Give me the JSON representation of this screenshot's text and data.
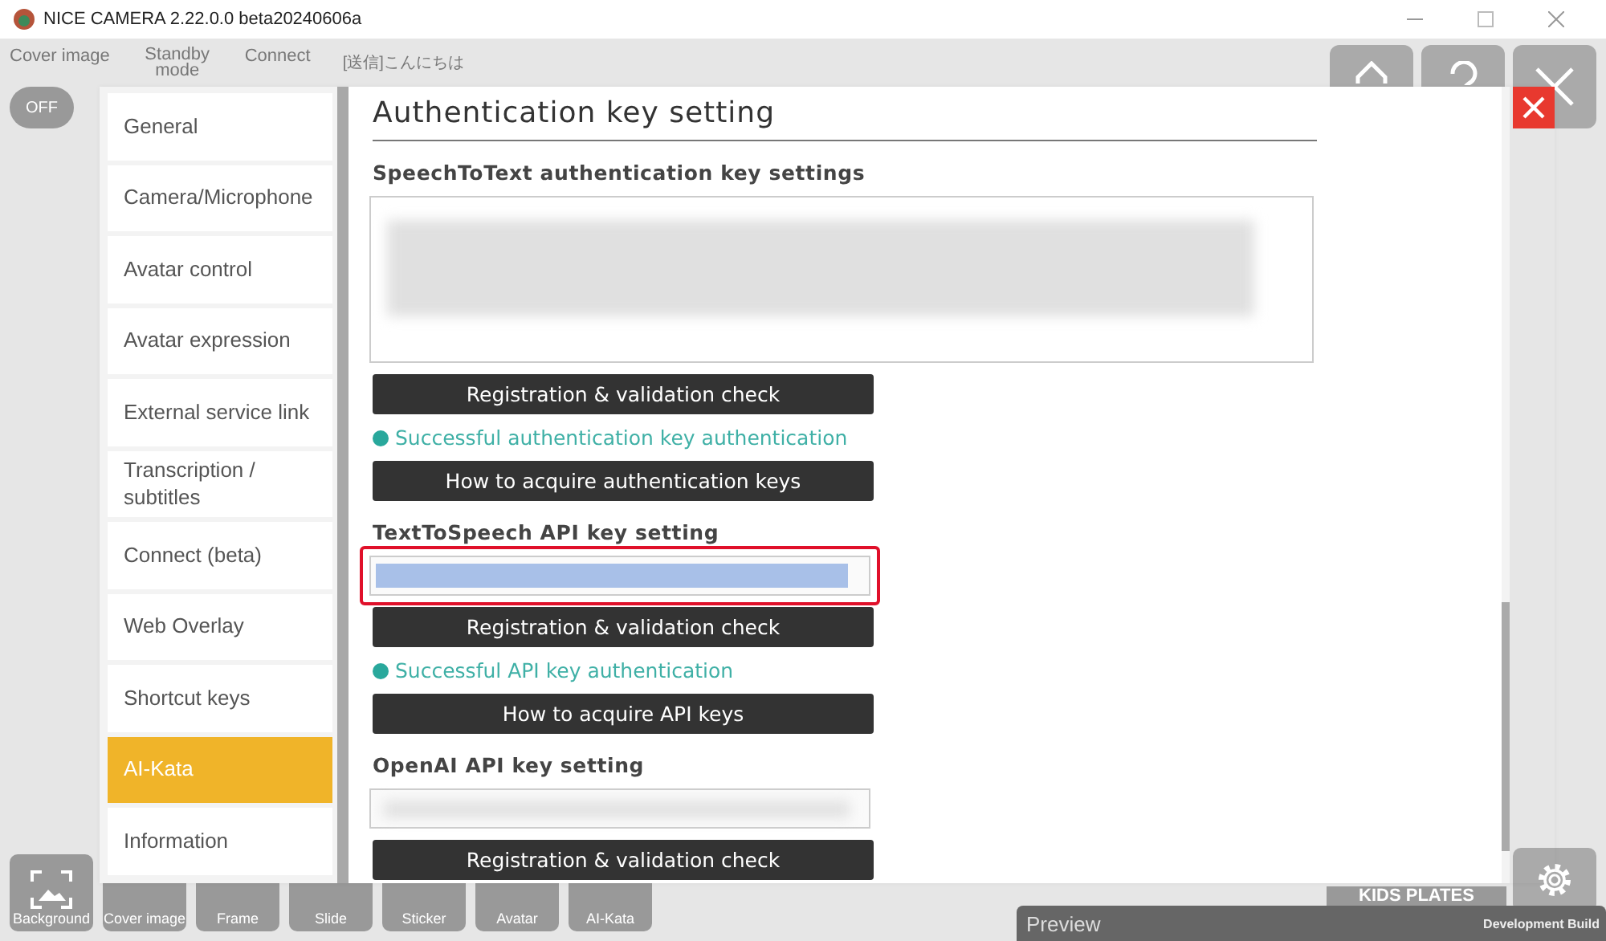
{
  "window": {
    "title": "NICE CAMERA 2.22.0.0 beta20240606a"
  },
  "toolbar": {
    "items": [
      {
        "label": "Cover image"
      },
      {
        "label": "Standby mode"
      },
      {
        "label": "Connect"
      }
    ],
    "message": "[送信]こんにちは",
    "toggle": {
      "label": "OFF",
      "on": false
    }
  },
  "sidebar": {
    "items": [
      {
        "label": "General",
        "selected": false
      },
      {
        "label": "Camera/Microphone",
        "selected": false
      },
      {
        "label": "Avatar control",
        "selected": false
      },
      {
        "label": "Avatar expression",
        "selected": false
      },
      {
        "label": "External service link",
        "selected": false
      },
      {
        "label": "Transcription / subtitles",
        "selected": false
      },
      {
        "label": "Connect (beta)",
        "selected": false
      },
      {
        "label": "Web Overlay",
        "selected": false
      },
      {
        "label": "Shortcut keys",
        "selected": false
      },
      {
        "label": "AI-Kata",
        "selected": true
      },
      {
        "label": "Information",
        "selected": false
      }
    ]
  },
  "panel": {
    "title": "Authentication key setting",
    "sections": [
      {
        "heading": "SpeechToText authentication key settings",
        "kind": "textarea",
        "highlighted": false,
        "register_button": "Registration & validation check",
        "status": {
          "text": "Successful authentication key authentication",
          "ok": true
        },
        "help_button": "How to acquire authentication keys"
      },
      {
        "heading": "TextToSpeech API key setting",
        "kind": "input",
        "highlighted": true,
        "register_button": "Registration & validation check",
        "status": {
          "text": "Successful API key authentication",
          "ok": true
        },
        "help_button": "How to acquire API keys"
      },
      {
        "heading": "OpenAI API key setting",
        "kind": "input",
        "highlighted": false,
        "register_button": "Registration & validation check"
      }
    ]
  },
  "bottom_toolbar": {
    "items": [
      {
        "label": "Background"
      },
      {
        "label": "Cover image"
      },
      {
        "label": "Frame"
      },
      {
        "label": "Slide"
      },
      {
        "label": "Sticker"
      },
      {
        "label": "Avatar"
      },
      {
        "label": "AI-Kata"
      }
    ]
  },
  "badge": "KIDS PLATES",
  "preview_bar": {
    "label": "Preview",
    "build": "Development Build"
  }
}
